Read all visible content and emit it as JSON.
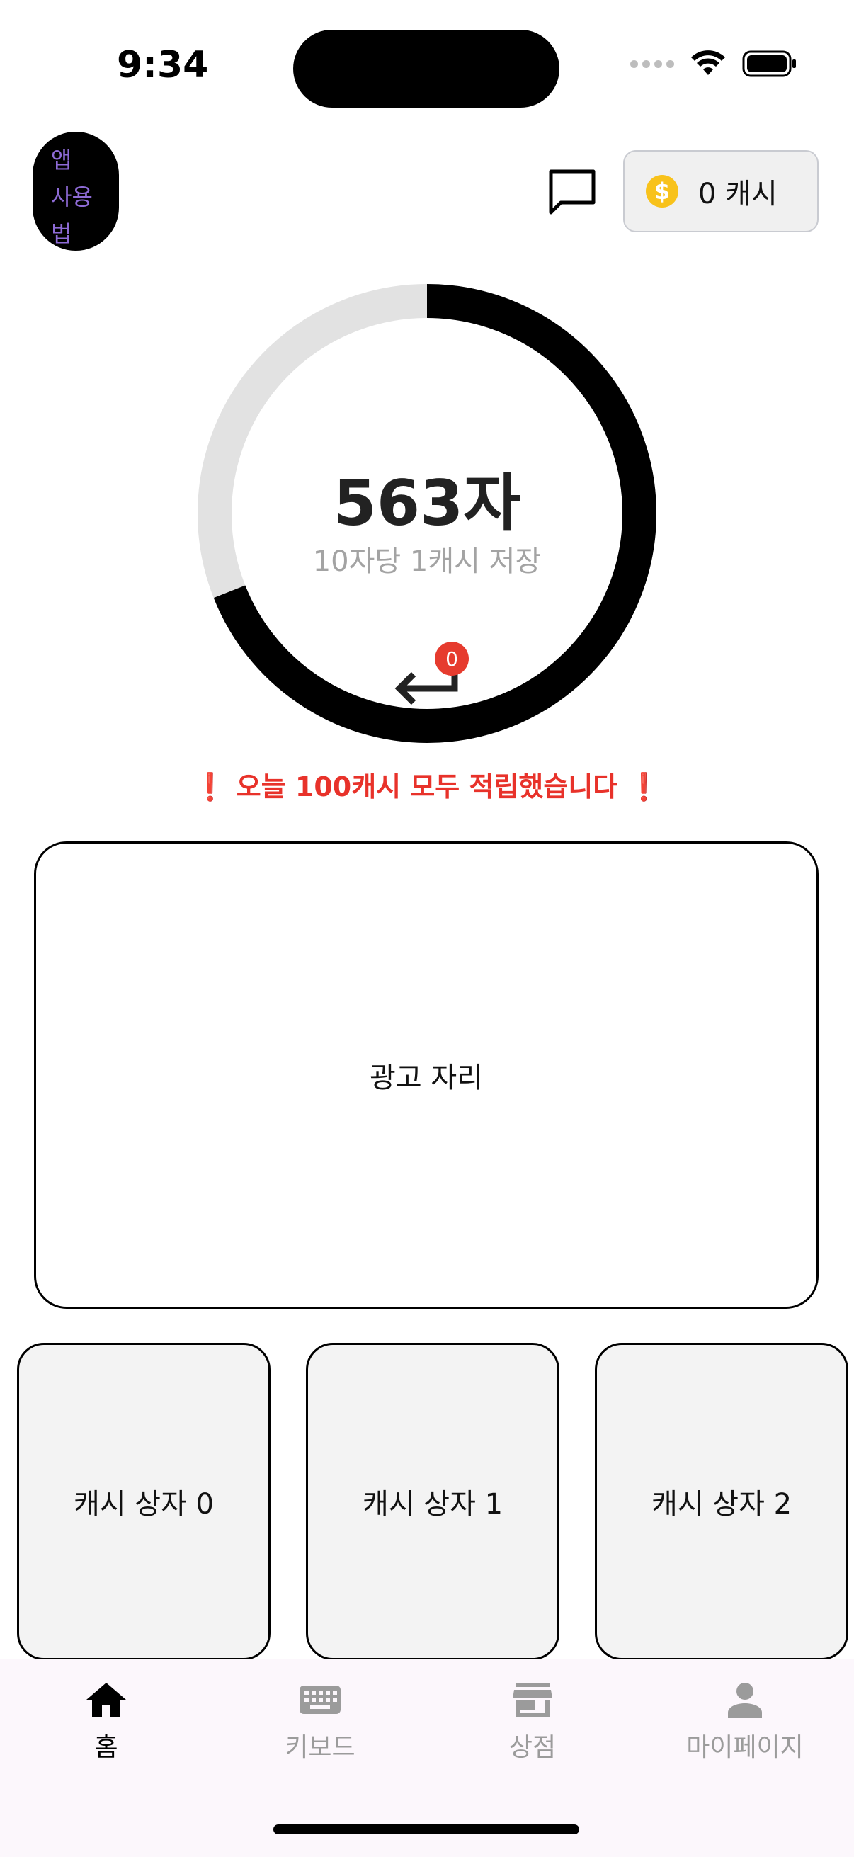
{
  "status_bar": {
    "time": "9:34"
  },
  "header": {
    "howto_label": "앱\n사용\n법",
    "cash_amount": "0 캐시",
    "coin_symbol": "$"
  },
  "gauge": {
    "count": "563자",
    "subtitle": "10자당 1캐시 저장",
    "progress": 0.69,
    "badge": "0",
    "colors": {
      "track": "#e2e2e2",
      "fill": "#000000"
    }
  },
  "notice": "❗️ 오늘 100캐시 모두 적립했습니다 ❗️",
  "ad": {
    "label": "광고 자리"
  },
  "cash_boxes": [
    {
      "label": "캐시 상자 0"
    },
    {
      "label": "캐시 상자 1"
    },
    {
      "label": "캐시 상자 2"
    }
  ],
  "tabs": [
    {
      "label": "홈",
      "icon": "home-icon",
      "active": true
    },
    {
      "label": "키보드",
      "icon": "keyboard-icon",
      "active": false
    },
    {
      "label": "상점",
      "icon": "store-icon",
      "active": false
    },
    {
      "label": "마이페이지",
      "icon": "person-icon",
      "active": false
    }
  ]
}
